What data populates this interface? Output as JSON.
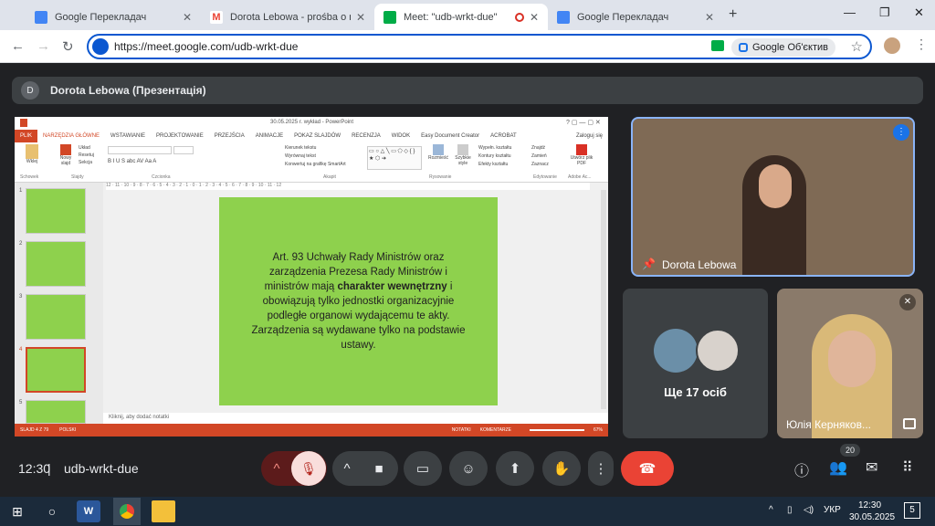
{
  "browser": {
    "tabs": [
      {
        "label": "Google Перекладач",
        "favicon": "google-translate-icon"
      },
      {
        "label": "Dorota Lebowa - prośba o możl",
        "favicon": "gmail-icon"
      },
      {
        "label": "Meet: \"udb-wrkt-due\"",
        "favicon": "google-meet-icon"
      },
      {
        "label": "Google Перекладач",
        "favicon": "google-translate-icon"
      }
    ],
    "url": "https://meet.google.com/udb-wrkt-due",
    "lens_label": "Google Об'єктив"
  },
  "meet": {
    "presenter_avatar": "D",
    "presenter_bar": "Dorota Lebowa (Презентація)",
    "participant_main": "Dorota Lebowa",
    "others_label": "Ще 17 осіб",
    "participant_3": "Юлія Керняков...",
    "time": "12:30",
    "meeting_code": "udb-wrkt-due",
    "people_count": "20"
  },
  "ppt": {
    "title": "30.05.2025 r. wykład - PowerPoint",
    "login": "Zaloguj się",
    "tabs": [
      "PLIK",
      "NARZĘDZIA GŁÓWNE",
      "WSTAWIANIE",
      "PROJEKTOWANIE",
      "PRZEJŚCIA",
      "ANIMACJE",
      "POKAZ SLAJDÓW",
      "RECENZJA",
      "WIDOK",
      "Easy Document Creator",
      "ACROBAT"
    ],
    "groups": [
      "Schowek",
      "Slajdy",
      "Czcionka",
      "Akapit",
      "Rysowanie",
      "Edytowanie",
      "Adobe Ac..."
    ],
    "buttons": {
      "paste": "Wklej",
      "new_slide": "Nowy slajd",
      "layout": "Układ",
      "reset": "Resetuj",
      "section": "Sekcja",
      "text_dir": "Kierunek tekstu",
      "align_text": "Wyrównaj tekst",
      "smartart": "Konwertuj na grafikę SmartArt",
      "arrange": "Rozmieść",
      "styles": "Szybkie style",
      "fill": "Wypełn. kształtu",
      "outline": "Kontury kształtu",
      "effects": "Efekty kształtu",
      "find": "Znajdź",
      "replace": "Zamień",
      "select": "Zaznacz",
      "pdf": "Utwórz plik PDF"
    },
    "slide_text_before": "Art. 93 Uchwały Rady Ministrów oraz zarządzenia Prezesa Rady Ministrów i ministrów mają ",
    "slide_text_bold": "charakter wewnętrzny",
    "slide_text_after": " i obowiązują tylko jednostki organizacyjnie podległe organowi wydającemu te akty. Zarządzenia są wydawane tylko na podstawie ustawy.",
    "notes_placeholder": "Kliknij, aby dodać notatki",
    "status_slide": "SLAJD 4 Z 79",
    "status_lang": "POLSKI",
    "status_notes": "NOTATKI",
    "status_comments": "KOMENTARZE",
    "zoom": "67%",
    "thumbs": [
      "1",
      "2",
      "3",
      "4",
      "5"
    ],
    "ruler": "12 · 11 · 10 · 9 · 8 · 7 · 6 · 5 · 4 · 3 · 2 · 1 · 0 · 1 · 2 · 3 · 4 · 5 · 6 · 7 · 8 · 9 · 10 · 11 · 12"
  },
  "taskbar": {
    "lang": "УКР",
    "time": "12:30",
    "date": "30.05.2025",
    "notif": "5"
  },
  "colors": {
    "accent": "#0b57d0",
    "ppt_orange": "#d24726",
    "slide_green": "#8ed14d",
    "end_call": "#ea4335"
  }
}
